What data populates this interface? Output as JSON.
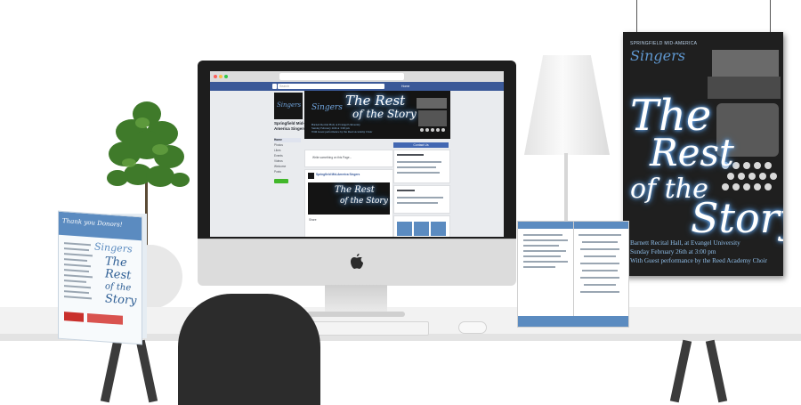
{
  "poster": {
    "brand": "SPRINGFIELD MID-AMERICA",
    "singers": "Singers",
    "title_line1": "The",
    "title_line2": "Rest",
    "title_line3": "of the",
    "title_line4": "Story",
    "venue": "Barnett Recital Hall, at Evangel University",
    "date": "Sunday February 26th at 3:00 pm",
    "guest": "With Guest performance by the Reed Academy Choir"
  },
  "facebook": {
    "search_placeholder": "Search",
    "nav_home": "Home",
    "page_name": "Springfield Mid-America Singers",
    "nav_items": [
      "Home",
      "Photos",
      "Likes",
      "Events",
      "Videos",
      "Welcome",
      "Posts"
    ],
    "contact_button": "Contact Us",
    "write_placeholder": "Write something on this Page...",
    "post_author": "Springfield Mid-America Singers",
    "post_action": "Share",
    "cover_brand": "Singers",
    "cover_title1": "The Rest",
    "cover_title2": "of the Story",
    "cover_venue": "Barnett Recital Hall, at Evangel University",
    "cover_date": "Sunday February 26th at 3:00 pm",
    "cover_guest": "With Guest performance by the Reed Academy Choir"
  },
  "menu_board": {
    "thanks": "Thank you Donors!",
    "singers": "Singers",
    "title1": "The",
    "title2": "Rest",
    "title3": "of the",
    "title4": "Story"
  },
  "colors": {
    "accent": "#5b8bc0",
    "poster_bg": "#1f1f1f",
    "facebook_blue": "#3b5998"
  }
}
